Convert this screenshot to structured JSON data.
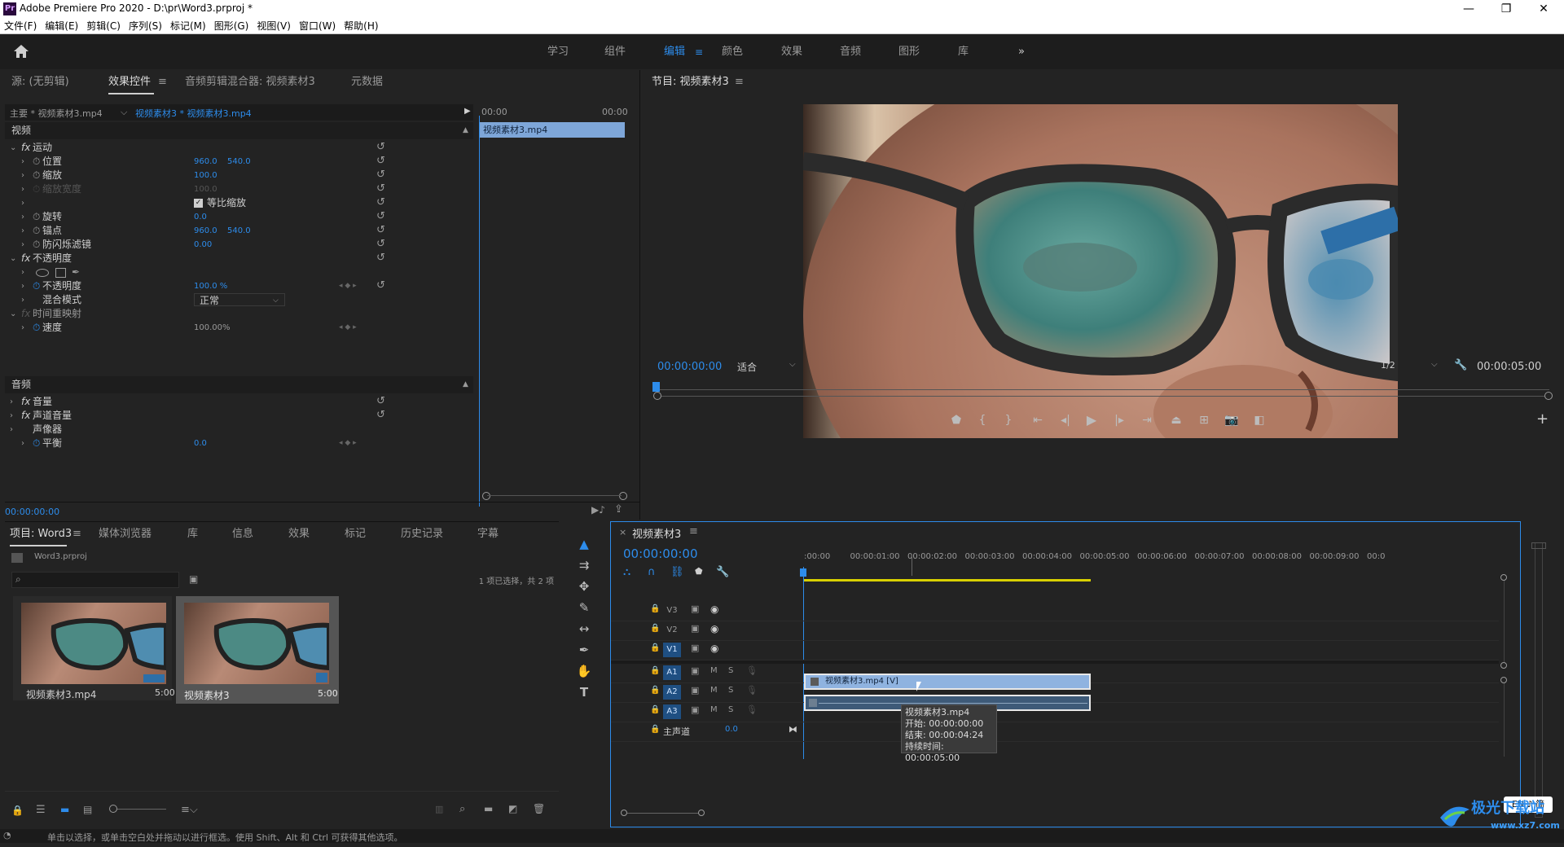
{
  "window": {
    "app_icon": "Pr",
    "title": "Adobe Premiere Pro 2020 - D:\\pr\\Word3.prproj *"
  },
  "menu": [
    "文件(F)",
    "编辑(E)",
    "剪辑(C)",
    "序列(S)",
    "标记(M)",
    "图形(G)",
    "视图(V)",
    "窗口(W)",
    "帮助(H)"
  ],
  "workspaces": [
    "学习",
    "组件",
    "编辑",
    "颜色",
    "效果",
    "音频",
    "图形",
    "库"
  ],
  "active_workspace": "编辑",
  "source_panel": {
    "tabs": [
      "源: (无剪辑)",
      "效果控件",
      "音频剪辑混合器: 视频素材3",
      "元数据"
    ],
    "master_label": "主要 * 视频素材3.mp4",
    "clip_label": "视频素材3 * 视频素材3.mp4",
    "time_start": "00:00",
    "time_end": "00:00",
    "clip_bar": "视频素材3.mp4",
    "section_video": "视频",
    "section_audio": "音频",
    "rows": [
      {
        "name": "运动",
        "fx": true,
        "level": 0
      },
      {
        "name": "位置",
        "v1": "960.0",
        "v2": "540.0",
        "level": 1
      },
      {
        "name": "缩放",
        "v1": "100.0",
        "level": 1
      },
      {
        "name": "缩放宽度",
        "v1": "100.0",
        "level": 1,
        "disabled": true
      },
      {
        "name": "等比缩放",
        "checkbox": true,
        "level": 1
      },
      {
        "name": "旋转",
        "v1": "0.0",
        "level": 1
      },
      {
        "name": "锚点",
        "v1": "960.0",
        "v2": "540.0",
        "level": 1
      },
      {
        "name": "防闪烁滤镜",
        "v1": "0.00",
        "level": 1
      },
      {
        "name": "不透明度",
        "fx": true,
        "level": 0
      },
      {
        "name": "shapes",
        "level": 1
      },
      {
        "name": "不透明度",
        "v1": "100.0 %",
        "level": 1,
        "keyframe": true
      },
      {
        "name": "混合模式",
        "select": "正常",
        "level": 1
      },
      {
        "name": "时间重映射",
        "fx": true,
        "level": 0,
        "dimfx": true
      },
      {
        "name": "速度",
        "v1": "100.00%",
        "level": 1,
        "keyframe": true,
        "plainval": true
      }
    ],
    "audio_rows": [
      {
        "name": "音量",
        "fx": true,
        "level": 0
      },
      {
        "name": "声道音量",
        "fx": true,
        "level": 0
      },
      {
        "name": "声像器",
        "fx": false,
        "level": 0
      },
      {
        "name": "平衡",
        "v1": "0.0",
        "level": 1,
        "keyframe": true
      }
    ],
    "timecode": "00:00:00:00"
  },
  "program_panel": {
    "title": "节目: 视频素材3",
    "timecode": "00:00:00:00",
    "fit": "适合",
    "quality": "1/2",
    "duration": "00:00:05:00"
  },
  "project_panel": {
    "tabs": [
      "项目: Word3",
      "媒体浏览器",
      "库",
      "信息",
      "效果",
      "标记",
      "历史记录",
      "字幕"
    ],
    "project_file": "Word3.prproj",
    "selection_info": "1 项已选择，共 2 项",
    "items": [
      {
        "name": "视频素材3.mp4",
        "duration": "5:00"
      },
      {
        "name": "视频素材3",
        "duration": "5:00"
      }
    ]
  },
  "timeline": {
    "title": "视频素材3",
    "timecode": "00:00:00:00",
    "ruler": [
      ":00:00",
      "00:00:01:00",
      "00:00:02:00",
      "00:00:03:00",
      "00:00:04:00",
      "00:00:05:00",
      "00:00:06:00",
      "00:00:07:00",
      "00:00:08:00",
      "00:00:09:00",
      "00:0"
    ],
    "video_tracks": [
      "V3",
      "V2",
      "V1"
    ],
    "audio_tracks": [
      "A1",
      "A2",
      "A3"
    ],
    "audio_btn_m": "M",
    "audio_btn_s": "S",
    "master_label": "主声道",
    "master_value": "0.0",
    "clip_label": "视频素材3.mp4 [V]",
    "tooltip": [
      "视频素材3.mp4",
      "开始: 00:00:00:00",
      "结束: 00:00:04:24",
      "持续时间: 00:00:05:00"
    ]
  },
  "status_bar": "单击以选择，或单击空白处并拖动以进行框选。使用 Shift、Alt 和 Ctrl 可获得其他选项。",
  "ime_badge": "EN ♪ 简",
  "watermark": "极光下载站\nwww.xz7.com",
  "colors": {
    "accent": "#2d8ceb",
    "clip_video": "#8fb3e0",
    "clip_audio": "#3e5a78"
  }
}
